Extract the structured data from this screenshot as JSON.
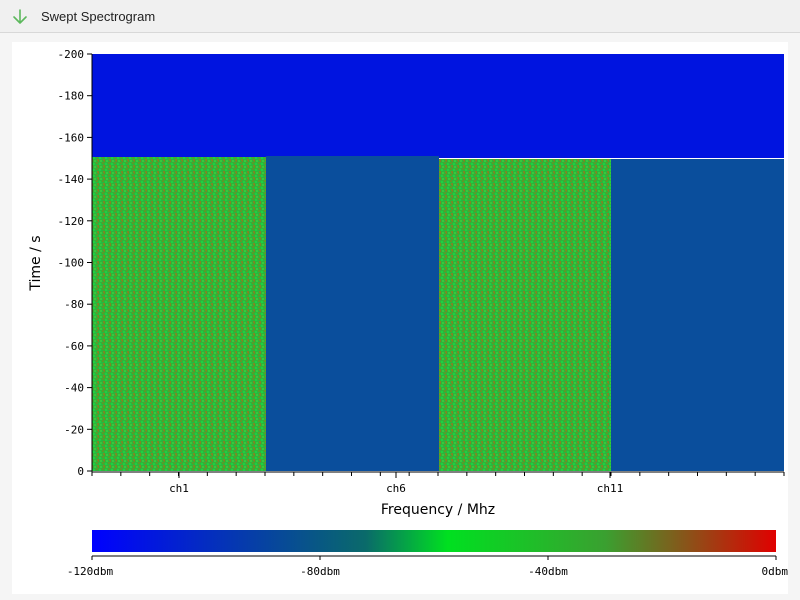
{
  "window": {
    "title": "Swept Spectrogram",
    "title_icon": "down-arrow-icon"
  },
  "colors": {
    "background_blue": "#0014e0",
    "channel_off_blue": "#0a4e9c",
    "channel_on_green": "#2eb43a",
    "axis": "#000000"
  },
  "chart_data": {
    "type": "heatmap",
    "title": "",
    "xlabel": "Frequency / Mhz",
    "ylabel": "Time / s",
    "ylim": [
      0,
      -200
    ],
    "y_ticks": [
      "0",
      "-20",
      "-40",
      "-60",
      "-80",
      "-100",
      "-120",
      "-140",
      "-160",
      "-180",
      "-200"
    ],
    "x_ticks": [
      "ch1",
      "ch6",
      "ch11"
    ],
    "regions": [
      {
        "channel_span": "ch1",
        "time_start": 0,
        "time_end": -150,
        "level": "high (approx -60dbm, green)"
      },
      {
        "channel_span": "ch6",
        "time_start": 0,
        "time_end": -150,
        "level": "low (dark blue)"
      },
      {
        "channel_span": "ch11",
        "time_start": 0,
        "time_end": -149,
        "level": "high (approx -60dbm, green)"
      },
      {
        "channel_span": "upper band",
        "time_start": -150,
        "time_end": -200,
        "level": "floor (-120dbm, blue)"
      }
    ],
    "colorbar": {
      "labels": [
        "-120dbm",
        "-80dbm",
        "-40dbm",
        "0dbm"
      ],
      "stops": [
        "#0000ff",
        "#00e020",
        "#e00000"
      ]
    }
  }
}
